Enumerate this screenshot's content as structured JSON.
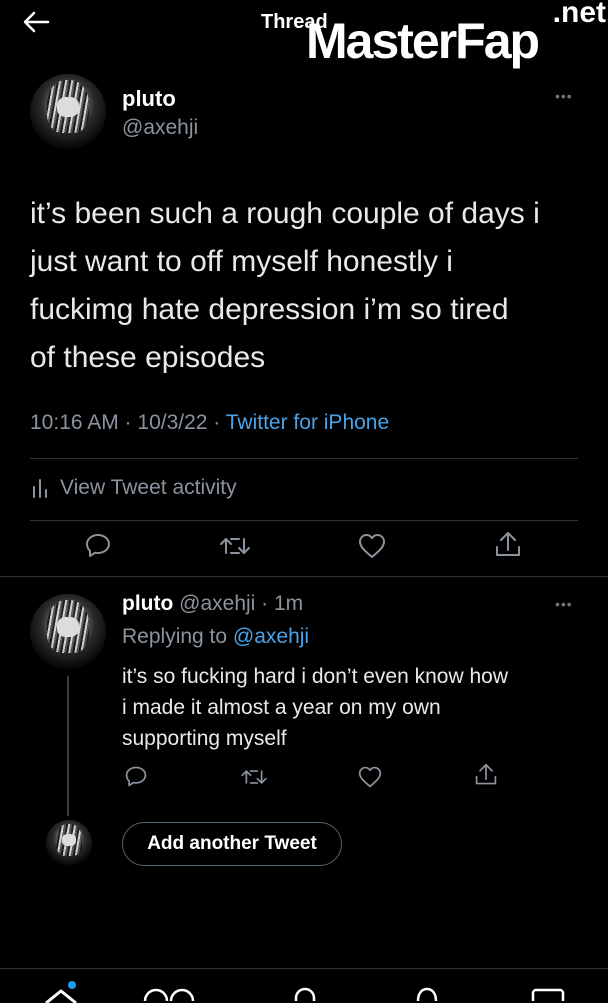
{
  "header": {
    "title": "Thread"
  },
  "watermark": {
    "main": "MasterFap",
    "suffix": ".net"
  },
  "main_tweet": {
    "display_name": "pluto",
    "handle": "@axehji",
    "text_lines": [
      "it’s been such a rough couple of days i",
      "just want to off myself honestly i",
      "fuckimg hate depression i’m so tired",
      "of these episodes"
    ],
    "timestamp": "10:16 AM · 10/3/22 · ",
    "source": "Twitter for iPhone",
    "activity_label": "View Tweet activity"
  },
  "reply": {
    "display_name": "pluto",
    "handle_time": "@axehji · 1m",
    "replying_prefix": "Replying to ",
    "replying_handle": "@axehji",
    "text_lines": [
      "it’s so fucking hard i don’t even know how",
      "i made it almost a year on my own",
      "supporting myself"
    ]
  },
  "compose": {
    "add_tweet_label": "Add another Tweet"
  },
  "colors": {
    "background": "#000000",
    "link": "#4aa3e8",
    "muted": "#8b949e",
    "text": "#e7e9ea"
  }
}
